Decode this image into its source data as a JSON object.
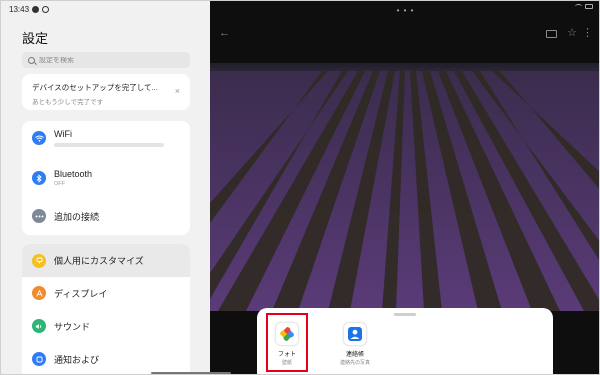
{
  "status": {
    "time": "13:43"
  },
  "settings": {
    "title": "設定",
    "search_placeholder": "設定を検索",
    "setup": {
      "title": "デバイスのセットアップを完了して...",
      "subtitle": "あともう少しで完了です",
      "close": "×"
    },
    "network": [
      {
        "label": "WiFi",
        "sub": "",
        "icon": "wifi-icon",
        "color": "#2f7cf6"
      },
      {
        "label": "Bluetooth",
        "sub": "OFF",
        "icon": "bluetooth-icon",
        "color": "#2f7cf6"
      },
      {
        "label": "追加の接続",
        "sub": "",
        "icon": "more-connections-icon",
        "color": "#7e8897"
      }
    ],
    "personal": [
      {
        "label": "個人用にカスタマイズ",
        "icon": "customize-icon",
        "color": "#f3c126"
      },
      {
        "label": "ディスプレイ",
        "icon": "display-icon",
        "color": "#f28b2c"
      },
      {
        "label": "サウンド",
        "icon": "sound-icon",
        "color": "#2bb673"
      },
      {
        "label": "通知および",
        "icon": "notification-icon",
        "color": "#2f7cf6"
      }
    ]
  },
  "viewer": {
    "top_dots": "• • •",
    "back": "←",
    "star": "☆",
    "more": "⋮"
  },
  "share_sheet": {
    "apps": [
      {
        "name": "フォト",
        "sub": "壁紙",
        "icon": "google-photos-icon",
        "selected": true
      },
      {
        "name": "連絡帳",
        "sub": "連絡先の写真",
        "icon": "contacts-icon",
        "selected": false
      }
    ],
    "highlight_color": "#e3001b"
  }
}
